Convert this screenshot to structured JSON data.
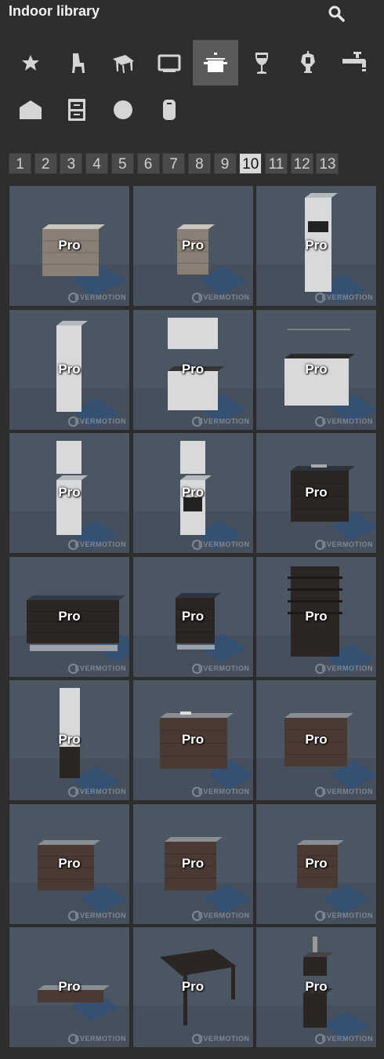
{
  "header": {
    "title": "Indoor library",
    "search_icon": "search-icon"
  },
  "categories": [
    {
      "name": "favorites-icon",
      "selected": false
    },
    {
      "name": "chair-icon",
      "selected": false
    },
    {
      "name": "table-icon",
      "selected": false
    },
    {
      "name": "tv-icon",
      "selected": false
    },
    {
      "name": "cooking-pot-icon",
      "selected": true
    },
    {
      "name": "wine-glass-icon",
      "selected": false
    },
    {
      "name": "lamp-icon",
      "selected": false
    },
    {
      "name": "faucet-icon",
      "selected": false
    },
    {
      "name": "house-icon",
      "selected": false
    },
    {
      "name": "cabinet-icon",
      "selected": false
    },
    {
      "name": "circle-icon",
      "selected": false
    },
    {
      "name": "cylinder-icon",
      "selected": false
    }
  ],
  "pagination": {
    "pages": [
      "1",
      "2",
      "3",
      "4",
      "5",
      "6",
      "7",
      "8",
      "9",
      "10",
      "11",
      "12",
      "13"
    ],
    "current": "10"
  },
  "colors": {
    "background": "#2e2e2e",
    "tile": "#4b5663",
    "selected_category": "#5a5a5a",
    "current_page": "#d9d9d9"
  },
  "tiles": [
    {
      "badge": "Pro",
      "watermark": "EVERMOTION",
      "model": "wood-cabinet"
    },
    {
      "badge": "Pro",
      "watermark": "EVERMOTION",
      "model": "narrow-wood-cabinet"
    },
    {
      "badge": "Pro",
      "watermark": "EVERMOTION",
      "model": "tall-oven-unit"
    },
    {
      "badge": "Pro",
      "watermark": "EVERMOTION",
      "model": "tall-white-cabinet"
    },
    {
      "badge": "Pro",
      "watermark": "EVERMOTION",
      "model": "white-cabinet-with-wall-unit"
    },
    {
      "badge": "Pro",
      "watermark": "EVERMOTION",
      "model": "white-island"
    },
    {
      "badge": "Pro",
      "watermark": "EVERMOTION",
      "model": "white-tall-column"
    },
    {
      "badge": "Pro",
      "watermark": "EVERMOTION",
      "model": "white-oven-column"
    },
    {
      "badge": "Pro",
      "watermark": "EVERMOTION",
      "model": "dark-island-cooktop"
    },
    {
      "badge": "Pro",
      "watermark": "EVERMOTION",
      "model": "dark-long-island"
    },
    {
      "badge": "Pro",
      "watermark": "EVERMOTION",
      "model": "dark-small-cabinet"
    },
    {
      "badge": "Pro",
      "watermark": "EVERMOTION",
      "model": "dark-shelving-unit"
    },
    {
      "badge": "Pro",
      "watermark": "EVERMOTION",
      "model": "dark-tall-column"
    },
    {
      "badge": "Pro",
      "watermark": "EVERMOTION",
      "model": "brown-island-sink"
    },
    {
      "badge": "Pro",
      "watermark": "EVERMOTION",
      "model": "brown-island"
    },
    {
      "badge": "Pro",
      "watermark": "EVERMOTION",
      "model": "brown-cabinet-wide"
    },
    {
      "badge": "Pro",
      "watermark": "EVERMOTION",
      "model": "brown-cabinet"
    },
    {
      "badge": "Pro",
      "watermark": "EVERMOTION",
      "model": "brown-small-cabinet"
    },
    {
      "badge": "Pro",
      "watermark": "EVERMOTION",
      "model": "low-flat-box"
    },
    {
      "badge": "Pro",
      "watermark": "EVERMOTION",
      "model": "dining-table"
    },
    {
      "badge": "Pro",
      "watermark": "EVERMOTION",
      "model": "small-appliance-column"
    }
  ]
}
